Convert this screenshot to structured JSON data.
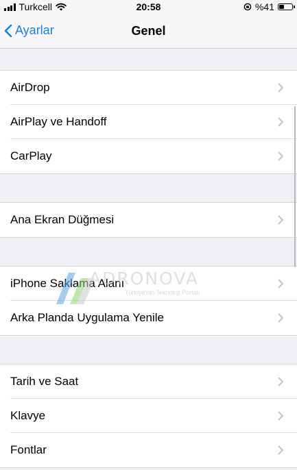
{
  "status_bar": {
    "carrier": "Turkcell",
    "time": "20:58",
    "battery_text": "%41",
    "battery_level": 0.41
  },
  "nav": {
    "back_label": "Ayarlar",
    "title": "Genel"
  },
  "groups": [
    [
      "AirDrop",
      "AirPlay ve Handoff",
      "CarPlay"
    ],
    [
      "Ana Ekran Düğmesi"
    ],
    [
      "iPhone Saklama Alanı",
      "Arka Planda Uygulama Yenile"
    ],
    [
      "Tarih ve Saat",
      "Klavye",
      "Fontlar"
    ]
  ],
  "watermark": {
    "name": "ADRONOVA",
    "tagline": "Türkiye'nin Teknoloji Portalı"
  },
  "colors": {
    "accent": "#157efb",
    "background": "#efeff4"
  }
}
